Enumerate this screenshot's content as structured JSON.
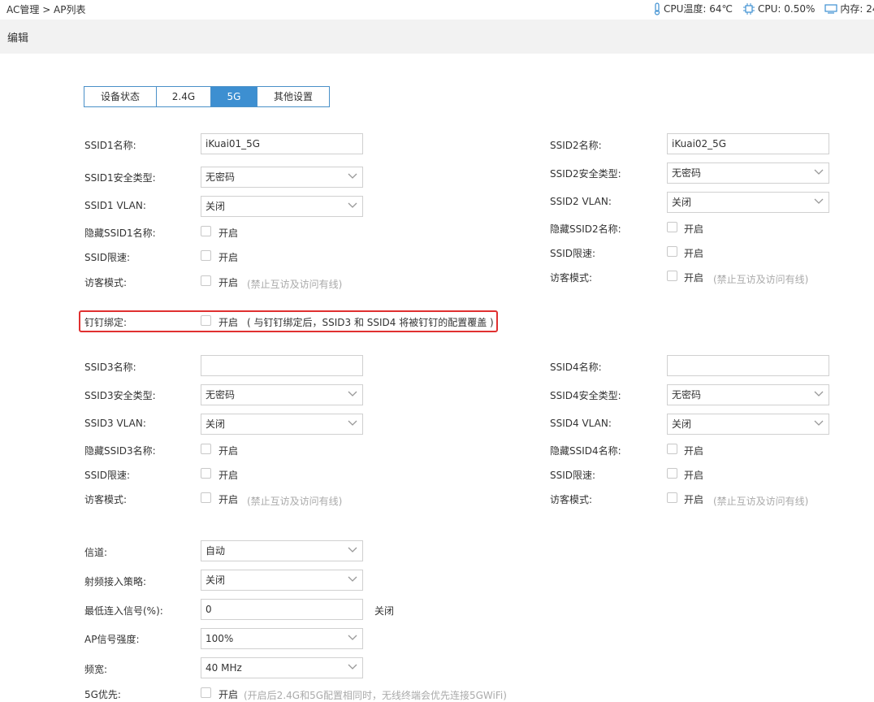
{
  "breadcrumb": "AC管理 > AP列表",
  "status": {
    "cpu_temp": "CPU温度: 64℃",
    "cpu": "CPU: 0.50%",
    "memory": "内存: 24"
  },
  "edit_title": "编辑",
  "tabs": [
    {
      "label": "设备状态",
      "active": false
    },
    {
      "label": "2.4G",
      "active": false
    },
    {
      "label": "5G",
      "active": true
    },
    {
      "label": "其他设置",
      "active": false
    }
  ],
  "enable_label": "开启",
  "guest_hint": "(禁止互访及访问有线)",
  "ssid1": {
    "name_label": "SSID1名称:",
    "name_value": "iKuai01_5G",
    "security_label": "SSID1安全类型:",
    "security_value": "无密码",
    "vlan_label": "SSID1 VLAN:",
    "vlan_value": "关闭",
    "hide_label": "隐藏SSID1名称:",
    "limit_label": "SSID限速:",
    "guest_label": "访客模式:"
  },
  "ssid2": {
    "name_label": "SSID2名称:",
    "name_value": "iKuai02_5G",
    "security_label": "SSID2安全类型:",
    "security_value": "无密码",
    "vlan_label": "SSID2 VLAN:",
    "vlan_value": "关闭",
    "hide_label": "隐藏SSID2名称:",
    "limit_label": "SSID限速:",
    "guest_label": "访客模式:"
  },
  "dingtalk": {
    "label": "钉钉绑定:",
    "hint": "( 与钉钉绑定后，SSID3 和 SSID4 将被钉钉的配置覆盖 )"
  },
  "ssid3": {
    "name_label": "SSID3名称:",
    "name_value": "",
    "security_label": "SSID3安全类型:",
    "security_value": "无密码",
    "vlan_label": "SSID3 VLAN:",
    "vlan_value": "关闭",
    "hide_label": "隐藏SSID3名称:",
    "limit_label": "SSID限速:",
    "guest_label": "访客模式:"
  },
  "ssid4": {
    "name_label": "SSID4名称:",
    "name_value": "",
    "security_label": "SSID4安全类型:",
    "security_value": "无密码",
    "vlan_label": "SSID4 VLAN:",
    "vlan_value": "关闭",
    "hide_label": "隐藏SSID4名称:",
    "limit_label": "SSID限速:",
    "guest_label": "访客模式:"
  },
  "radio": {
    "channel_label": "信道:",
    "channel_value": "自动",
    "rf_label": "射频接入策略:",
    "rf_value": "关闭",
    "min_signal_label": "最低连入信号(%):",
    "min_signal_value": "0",
    "min_signal_suffix": "关闭",
    "power_label": "AP信号强度:",
    "power_value": "100%",
    "bandwidth_label": "频宽:",
    "bandwidth_value": "40 MHz",
    "prefer_label": "5G优先:",
    "prefer_hint": "(开启后2.4G和5G配置相同时，无线终端会优先连接5GWiFi)"
  }
}
